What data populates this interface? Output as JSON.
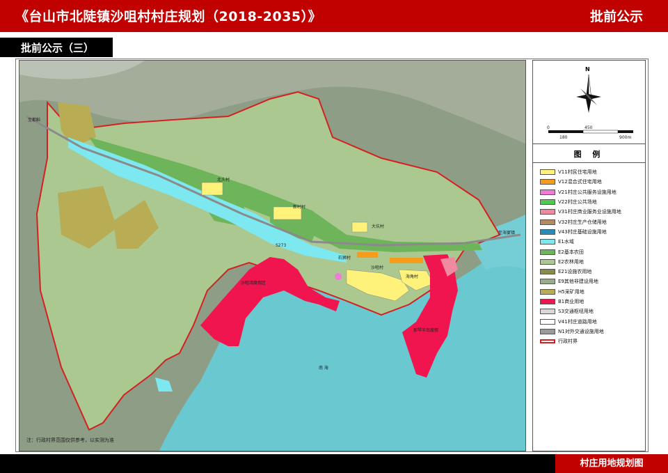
{
  "header": {
    "title": "《台山市北陡镇沙咀村村庄规划（2018-2035）》",
    "right_label": "批前公示"
  },
  "subheader": {
    "label": "批前公示（三）"
  },
  "map": {
    "note": "注：行政村界范围仅供参考，以实测为准",
    "places": {
      "sea": "南 海",
      "village_1": "北头村",
      "village_2": "新村村",
      "village_3": "大坑村",
      "village_4": "沙咀村",
      "village_5": "石狮村",
      "village_6": "海角村",
      "zone_1": "沙咀湾度假区",
      "zone_2": "那琴半岛度假",
      "road_1": "至都斛",
      "road_2": "至海宴镇",
      "road_3": "S273"
    }
  },
  "compass": {
    "north": "N",
    "scale_top": [
      "0",
      "450"
    ],
    "scale_bottom": [
      "180",
      "900m"
    ]
  },
  "legend": {
    "title": "图 例",
    "items": [
      {
        "label": "V11村民住宅用地",
        "color": "#fff27a"
      },
      {
        "label": "V12混合式住宅用地",
        "color": "#f59c1a"
      },
      {
        "label": "V21村庄公共服务设施用地",
        "color": "#f07ad8"
      },
      {
        "label": "V22村庄公共场地",
        "color": "#4fc94f"
      },
      {
        "label": "V31村庄商业服务业设施用地",
        "color": "#f08aa0"
      },
      {
        "label": "V32村庄生产仓储用地",
        "color": "#b58a60"
      },
      {
        "label": "V43村庄基础设施用地",
        "color": "#2a8ab8"
      },
      {
        "label": "E1水域",
        "color": "#7de8ef"
      },
      {
        "label": "E2基本农田",
        "color": "#6db45a"
      },
      {
        "label": "E2农林用地",
        "color": "#aac890"
      },
      {
        "label": "E21设施农用地",
        "color": "#8a8a4a"
      },
      {
        "label": "E9其他非建设用地",
        "color": "#9aab88"
      },
      {
        "label": "H5采矿用地",
        "color": "#b8ac55"
      },
      {
        "label": "B1商业用地",
        "color": "#f0154e"
      },
      {
        "label": "S3交通枢纽用地",
        "color": "#d8d8d8"
      },
      {
        "label": "V41村庄道路用地",
        "color": "#ffffff"
      },
      {
        "label": "N1对外交通设施用地",
        "color": "#9a9a9a"
      },
      {
        "label": "行政村界",
        "color": "#d42020"
      }
    ]
  },
  "footer": {
    "label": "村庄用地规划图"
  }
}
